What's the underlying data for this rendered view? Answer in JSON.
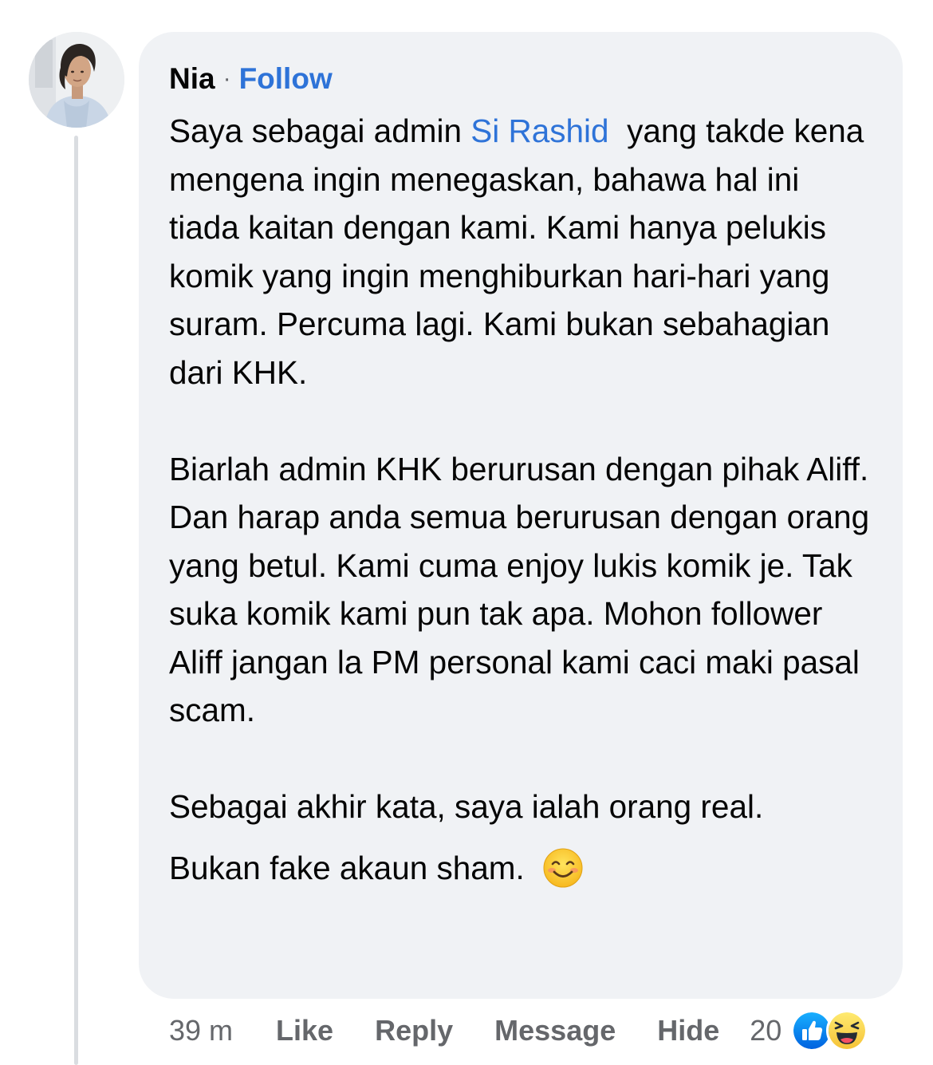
{
  "comment": {
    "author": "Nia",
    "separator": "·",
    "follow_label": "Follow",
    "body": {
      "p1_prefix": "Saya sebagai admin ",
      "p1_mention": "Si Rashid",
      "p1_rest": "  yang takde kena mengena ingin menegaskan, bahawa hal ini tiada kaitan dengan kami. Kami hanya pelukis komik yang ingin menghiburkan hari-hari yang suram. Percuma lagi. Kami bukan sebahagian dari KHK.",
      "p2": "Biarlah admin KHK berurusan dengan pihak Aliff. Dan harap anda semua berurusan dengan orang yang betul. Kami cuma enjoy lukis komik je. Tak suka komik kami pun tak apa. Mohon follower Aliff jangan la PM personal kami caci maki pasal scam.",
      "p3_line1": "Sebagai akhir kata, saya ialah orang real.",
      "p3_line2": "Bukan fake akaun sham."
    },
    "emoji_icon": "smiling-face-emoji",
    "actions": {
      "time": "39 m",
      "like": "Like",
      "reply": "Reply",
      "message": "Message",
      "hide": "Hide"
    },
    "reactions": {
      "count": "20",
      "icons": [
        "like-reaction-icon",
        "haha-reaction-icon"
      ]
    }
  },
  "colors": {
    "bubble_bg": "#f0f2f5",
    "link_blue": "#2e73d8",
    "secondary_text": "#65676b",
    "thread_line": "#dadde1"
  }
}
